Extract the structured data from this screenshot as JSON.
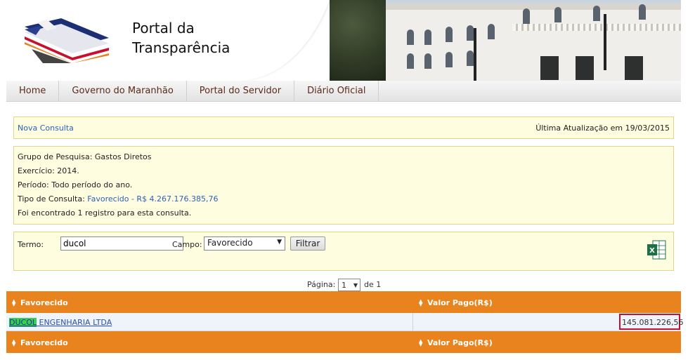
{
  "header": {
    "brand_line1": "Portal da",
    "brand_line2": "Transparência",
    "logo_icon": "maranhao-flag-logo"
  },
  "nav": {
    "items": [
      {
        "label": "Home"
      },
      {
        "label": "Governo do Maranhão"
      },
      {
        "label": "Portal do Servidor"
      },
      {
        "label": "Diário Oficial"
      }
    ]
  },
  "info_bar": {
    "new_query": "Nova Consulta",
    "last_update": "Última Atualização em 19/03/2015"
  },
  "summary": {
    "group": "Grupo de Pesquisa: Gastos Diretos",
    "year": "Exercício: 2014.",
    "period": "Período: Todo período do ano.",
    "type_label": "Tipo de Consulta: ",
    "type_link": "Favorecido - R$ 4.267.176.385,76",
    "records": "Foi encontrado 1 registro para esta consulta."
  },
  "filter": {
    "term_label": "Termo:",
    "term_value": "ducol",
    "field_label": "Campo:",
    "field_value": "Favorecido",
    "button_label": "Filtrar",
    "export_icon": "excel-export-icon"
  },
  "pager": {
    "label": "Página:",
    "page": "1",
    "of": "de 1"
  },
  "table": {
    "columns": [
      "Favorecido",
      "Valor Pago(R$)"
    ],
    "rows": [
      {
        "favorecido_highlight": "DUCOL",
        "favorecido_rest": " ENGENHARIA LTDA",
        "valor": "145.081.226,56"
      }
    ]
  },
  "colors": {
    "accent_orange": "#e8831e",
    "panel_bg": "#fffde0",
    "link_blue": "#2a62b8",
    "highlight_green": "#38d14d",
    "focus_red": "#c8102e"
  }
}
